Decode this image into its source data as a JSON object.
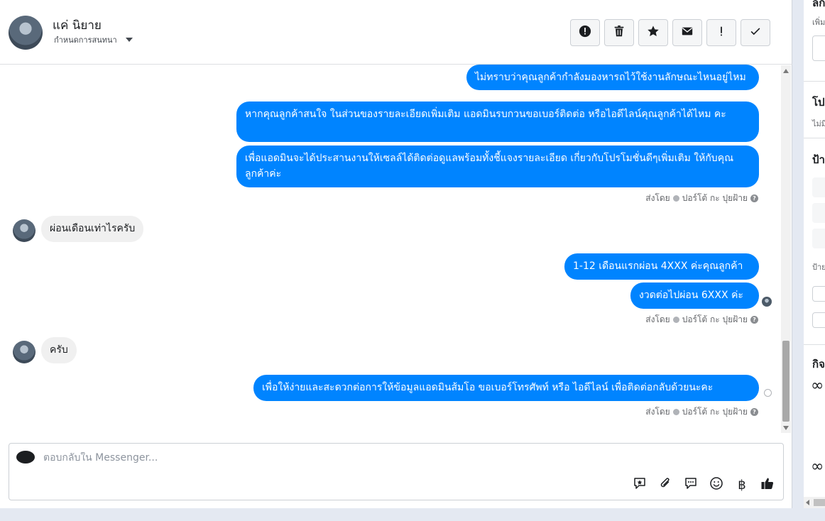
{
  "header": {
    "contact_name": "แค่ นิยาย",
    "assign_label": "กำหนดการสนทนา",
    "actions": [
      "alert-icon",
      "trash-icon",
      "star-icon",
      "mail-icon",
      "exclamation-icon",
      "check-icon"
    ]
  },
  "messages": {
    "out_1": "ไม่ทราบว่าคุณลูกค้ากำลังมองหารถไว้ใช้งานลักษณะไหนอยู่ไหมคะ",
    "out_2": "หากคุณลูกค้าสนใจ ในส่วนของรายละเอียดเพิ่มเติม แอดมินรบกวนขอเบอร์ติดต่อ หรือไอดีไลน์คุณลูกค้าได้ไหม คะ",
    "out_3": "เพื่อแอดมินจะได้ประสานงานให้เซลล์ได้ติดต่อดูแลพร้อมทั้งชี้แจงรายละเอียด เกี่ยวกับโปรโมชั่นดีๆเพิ่มเติม ให้กับคุณลูกค้าค่ะ",
    "sent_by_1": "ส่งโดย",
    "sender_1": "ปอร์โต้ กะ ปุยฝ้าย",
    "in_1": "ผ่อนเดือนเท่าไรครับ",
    "out_4": "1-12 เดือนแรกผ่อน 4XXX ค่ะคุณลูกค้า",
    "out_5": "งวดต่อไปผ่อน 6XXX ค่ะ",
    "sent_by_2": "ส่งโดย",
    "sender_2": "ปอร์โต้ กะ ปุยฝ้าย",
    "in_2": "ครับ",
    "out_6": "เพื่อให้ง่ายและสะดวกต่อการให้ข้อมูลแอดมินส้มโอ ขอเบอร์โทรศัพท์ หรือ ไอดีไลน์ เพื่อติดต่อกลับด้วยนะคะ",
    "sent_by_3": "ส่งโดย",
    "sender_3": "ปอร์โต้ กะ ปุยฝ้าย"
  },
  "composer": {
    "placeholder": "ตอบกลับใน Messenger...",
    "baht_symbol": "฿",
    "icons": [
      "saved-reply-icon",
      "attach-icon",
      "chat-icon",
      "emoji-icon",
      "baht-icon",
      "like-icon"
    ]
  },
  "right_panel": {
    "t1": "ลก",
    "s1": "เพิ่ม",
    "t2": "โป",
    "s2": "ไม่มี",
    "t3": "ป้า",
    "s3": "ป้าย",
    "t4": "กิจ",
    "loop": "∞"
  },
  "colors": {
    "outgoing_bubble": "#0084ff",
    "incoming_bubble": "#f0f0f0",
    "background": "#e4e9f2"
  }
}
